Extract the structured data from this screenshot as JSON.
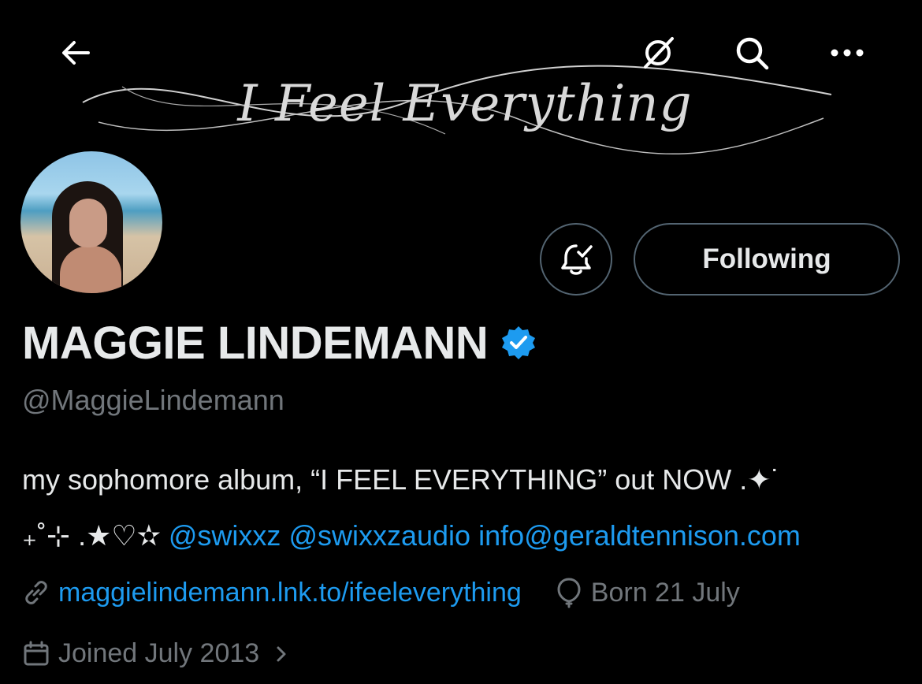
{
  "banner": {
    "title": "I Feel Everything"
  },
  "header": {
    "back_icon": "arrow-left-icon",
    "grok_icon": "grok-icon",
    "search_icon": "search-icon",
    "more_icon": "more-horizontal-icon"
  },
  "profile": {
    "display_name": "MAGGIE LINDEMANN",
    "handle": "@MaggieLindemann",
    "verified": true,
    "accent": "#1d9bf0"
  },
  "actions": {
    "notifications_icon": "bell-check-icon",
    "follow_label": "Following"
  },
  "bio": {
    "line1_text": "my sophomore album, “I FEEL EVERYTHING” out NOW .✦˙",
    "line2_prefix": "₊˚⊹ .★♡✫",
    "mention1": "@swixxz",
    "mention2": "@swixxzaudio",
    "email": "info@geraldtennison.com"
  },
  "meta": {
    "link": "maggielindemann.lnk.to/ifeeleverything",
    "birthday": "Born 21 July",
    "joined": "Joined July 2013"
  }
}
